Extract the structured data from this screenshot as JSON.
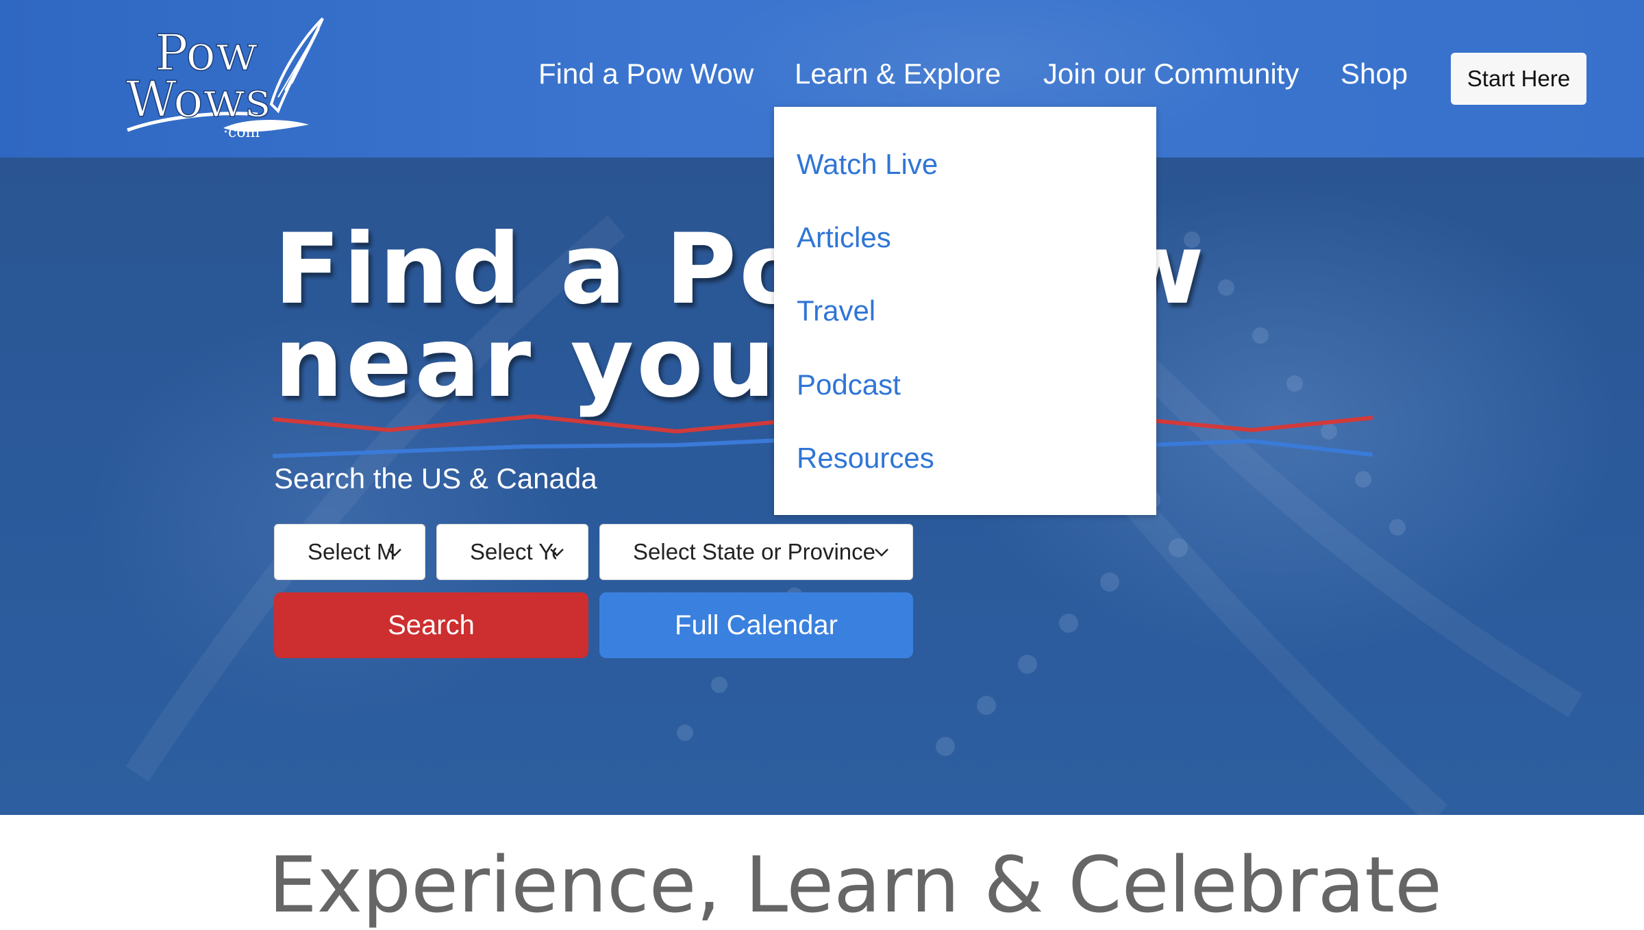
{
  "brand": {
    "logo_text": "PowWows.com"
  },
  "nav": {
    "items": [
      {
        "label": "Find a Pow Wow"
      },
      {
        "label": "Learn & Explore"
      },
      {
        "label": "Join our Community"
      },
      {
        "label": "Shop"
      }
    ],
    "cta_label": "Start Here"
  },
  "dropdown": {
    "items": [
      {
        "label": "Watch Live"
      },
      {
        "label": "Articles"
      },
      {
        "label": "Travel"
      },
      {
        "label": "Podcast"
      },
      {
        "label": "Resources"
      }
    ]
  },
  "hero": {
    "title_line1": "Find a Pow Wow",
    "title_line2": "near you",
    "subtitle": "Search the US & Canada",
    "selects": {
      "month": "Select Month",
      "year": "Select Year",
      "state": "Select State or Province"
    },
    "search_label": "Search",
    "calendar_label": "Full Calendar"
  },
  "section": {
    "heading": "Experience, Learn & Celebrate"
  },
  "colors": {
    "header_blue": "#3b75cf",
    "dropdown_link": "#2f75d6",
    "search_red": "#cd2e2f",
    "calendar_blue": "#3a80de",
    "line_red": "#d23a3a",
    "line_blue": "#3a7ad8"
  }
}
